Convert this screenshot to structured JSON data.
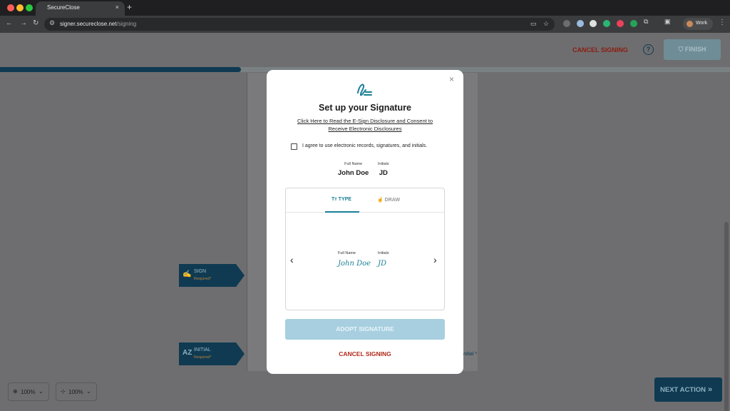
{
  "browser": {
    "tab_title": "SecureClose",
    "tab_close": "×",
    "new_tab": "+",
    "url_host": "signer.secureclose.net",
    "url_path": "/signing",
    "profile_label": "Work"
  },
  "header": {
    "cancel_label": "CANCEL SIGNING",
    "help_label": "?",
    "finish_label": "FINISH"
  },
  "progress": {
    "fraction": 0.33
  },
  "flags": {
    "sign": {
      "icon": "✍",
      "label": "SIGN",
      "sub": "Required*"
    },
    "initial": {
      "icon": "AZ",
      "label": "INITIAL",
      "sub": "Required*"
    }
  },
  "doc": {
    "initial_marker": "Initial *"
  },
  "zoom": {
    "left_value": "100%",
    "right_value": "100%"
  },
  "next_action": {
    "label": "NEXT ACTION",
    "arrows": "»"
  },
  "modal": {
    "close": "×",
    "title": "Set up your Signature",
    "disclosure_line1": "Click Here to Read the E-Sign Disclosure and Consent to",
    "disclosure_line2": "Receive Electronic Disclosures",
    "consent_label": "I agree to use electronic records, signatures, and initials.",
    "full_name_label": "Full Name",
    "full_name": "John Doe",
    "initials_label": "Initials",
    "initials": "JD",
    "tabs": {
      "type": "TYPE",
      "draw": "DRAW"
    },
    "preview": {
      "full_name_label": "Full Name",
      "full_name_sig": "John Doe",
      "initials_label": "Initials",
      "initials_sig": "JD"
    },
    "adopt_label": "ADOPT SIGNATURE",
    "cancel_label": "CANCEL SIGNING"
  },
  "colors": {
    "brand": "#0f3a52",
    "accent": "#1a7f96",
    "danger": "#b0281a"
  }
}
